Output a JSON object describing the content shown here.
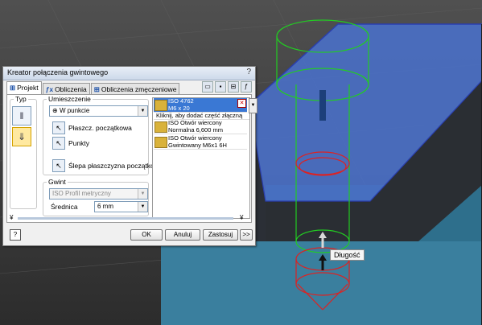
{
  "dialog": {
    "title": "Kreator połączenia gwintowego",
    "help_icon": "?",
    "tabs": [
      "Projekt",
      "Obliczenia",
      "Obliczenia zmęczeniowe"
    ],
    "typ_label": "Typ",
    "umieszczenie": {
      "legend": "Umieszczenie",
      "mode": "W punkcie",
      "plaszczyzna": "Płaszcz. początkowa",
      "punkty": "Punkty",
      "slepa": "Ślepa płaszczyzna początkowa"
    },
    "gwint": {
      "legend": "Gwint",
      "type": "ISO Profil metryczny",
      "srednica_label": "Średnica",
      "srednica_value": "6 mm"
    },
    "list": {
      "selected_line1": "ISO 4762",
      "selected_line2": "M6 x 20",
      "hint": "Kliknij, aby dodać część złączną",
      "item1_line1": "ISO Otwór wiercony",
      "item1_line2": "Normalna 6,600 mm",
      "item2_line1": "ISO Otwór wiercony",
      "item2_line2": "Gwintowany M6x1 6H"
    },
    "buttons": {
      "ok": "OK",
      "cancel": "Anuluj",
      "apply": "Zastosuj",
      "more": ">>"
    }
  },
  "tooltip": "Długość",
  "colors": {
    "wire_green": "#22cc22",
    "wire_red": "#dd2222",
    "face_blue": "#4a6fc4",
    "side_teal": "#3a7f9e"
  }
}
